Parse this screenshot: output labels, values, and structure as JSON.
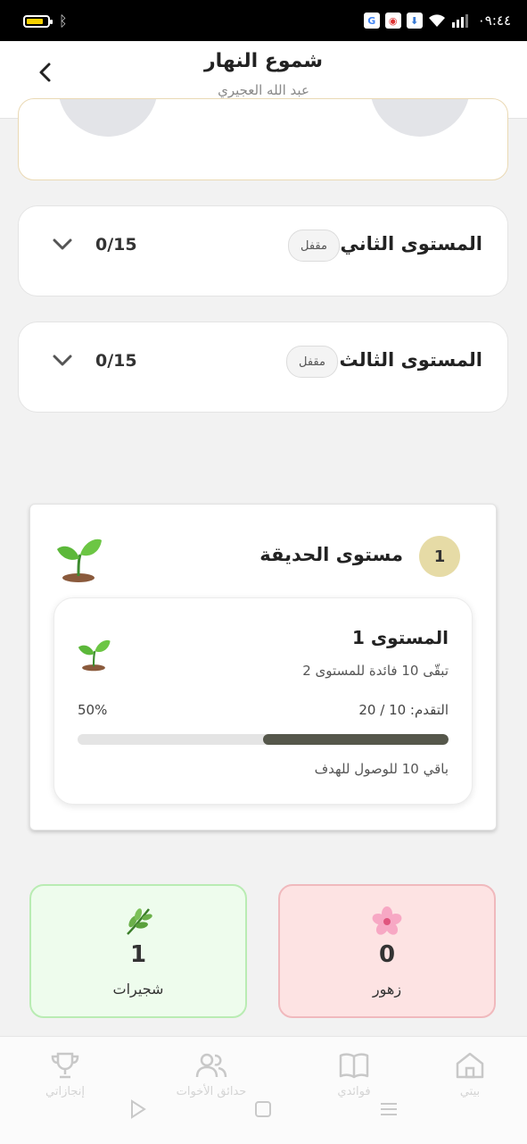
{
  "status_bar": {
    "time": "٠٩:٤٤"
  },
  "header": {
    "title": "شموع النهار",
    "subtitle": "عبد الله العجيري"
  },
  "levels": [
    {
      "title": "المستوى الثاني",
      "badge": "مقفل",
      "count": "0/15"
    },
    {
      "title": "المستوى الثالث",
      "badge": "مقفل",
      "count": "0/15"
    }
  ],
  "garden": {
    "badge_number": "1",
    "title": "مستوى الحديقة",
    "level_title": "المستوى 1",
    "remaining_text": "تبقّى 10 فائدة للمستوى 2",
    "progress_label": "التقدم: 10 / 20",
    "progress_percent_text": "50%",
    "progress_fraction": 0.5,
    "goal_text": "باقي 10 للوصول للهدف"
  },
  "stats": [
    {
      "icon": "herb-icon",
      "value": "1",
      "label": "شجيرات",
      "color": "#eefced"
    },
    {
      "icon": "flower-icon",
      "value": "0",
      "label": "زهور",
      "color": "#fde3e3"
    }
  ],
  "bottom_nav": [
    {
      "label": "بيتي",
      "icon": "home-icon"
    },
    {
      "label": "فوائدي",
      "icon": "book-icon"
    },
    {
      "label": "حدائق الأخوات",
      "icon": "users-icon"
    },
    {
      "label": "إنجازاتي",
      "icon": "trophy-icon"
    }
  ],
  "colors": {
    "progress": "#55574b",
    "badge": "#e6dba6",
    "accent_border": "#ead9b4"
  }
}
